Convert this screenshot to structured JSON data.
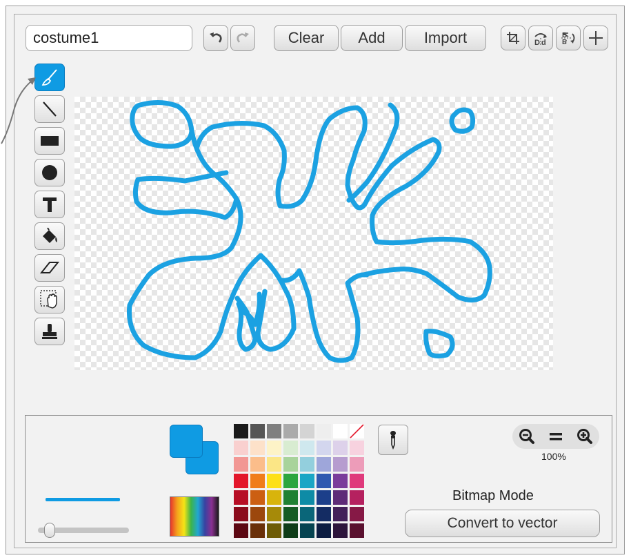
{
  "costume": {
    "name": "costume1",
    "name_placeholder": ""
  },
  "toolbar": {
    "clear_label": "Clear",
    "add_label": "Add",
    "import_label": "Import",
    "undo_icon": "undo-icon",
    "redo_icon": "redo-icon",
    "crop_icon": "crop-icon",
    "flip_horizontal_icon": "flip-horizontal-icon",
    "flip_vertical_icon": "flip-vertical-icon",
    "set_center_icon": "set-center-icon"
  },
  "tools": [
    {
      "name": "brush",
      "icon": "brush-icon",
      "active": true
    },
    {
      "name": "line",
      "icon": "line-icon",
      "active": false
    },
    {
      "name": "rectangle",
      "icon": "rectangle-icon",
      "active": false
    },
    {
      "name": "ellipse",
      "icon": "ellipse-icon",
      "active": false
    },
    {
      "name": "text",
      "icon": "text-icon",
      "active": false
    },
    {
      "name": "fill",
      "icon": "paint-bucket-icon",
      "active": false
    },
    {
      "name": "eraser",
      "icon": "eraser-icon",
      "active": false
    },
    {
      "name": "select",
      "icon": "select-hand-icon",
      "active": false
    },
    {
      "name": "stamp",
      "icon": "stamp-icon",
      "active": false
    }
  ],
  "colors": {
    "accent": "#0f9be3",
    "primary_color": "#0f9be3",
    "secondary_color": "#0f9be3"
  },
  "palette": [
    "#1a1a1a",
    "#555555",
    "#7f7f7f",
    "#aaaaaa",
    "#d4d4d4",
    "#eeeeee",
    "#ffffff",
    "transparent",
    "#f9d0cf",
    "#fde1c9",
    "#fdf3c7",
    "#d8ecd1",
    "#cfe8ee",
    "#d3d6ee",
    "#ddd1ea",
    "#f7d2df",
    "#f29794",
    "#fbbd8a",
    "#fbe686",
    "#a8d39b",
    "#93cfdd",
    "#9ea6da",
    "#b69ccf",
    "#ed9cb9",
    "#e3162a",
    "#f07d1a",
    "#fde019",
    "#2ca63f",
    "#1aa6c5",
    "#2f59b0",
    "#7a3c9b",
    "#df3a7c",
    "#b70e25",
    "#cc5f12",
    "#d8b40c",
    "#1f8133",
    "#0e8ba6",
    "#1c3f8a",
    "#5e2b78",
    "#b5215f",
    "#8b0b1c",
    "#9c470d",
    "#a68a09",
    "#155c24",
    "#0a6679",
    "#142c63",
    "#43205a",
    "#861946",
    "#5c0712",
    "#6a3009",
    "#6e5c06",
    "#0e3d18",
    "#064451",
    "#0d1d42",
    "#2d153c",
    "#5a112f"
  ],
  "zoom": {
    "level": "100%",
    "zoom_out_icon": "zoom-out-icon",
    "reset_icon": "zoom-reset-icon",
    "zoom_in_icon": "zoom-in-icon"
  },
  "mode": {
    "label": "Bitmap Mode",
    "convert_label": "Convert to vector"
  },
  "brush": {
    "size_fraction": 0.1
  }
}
